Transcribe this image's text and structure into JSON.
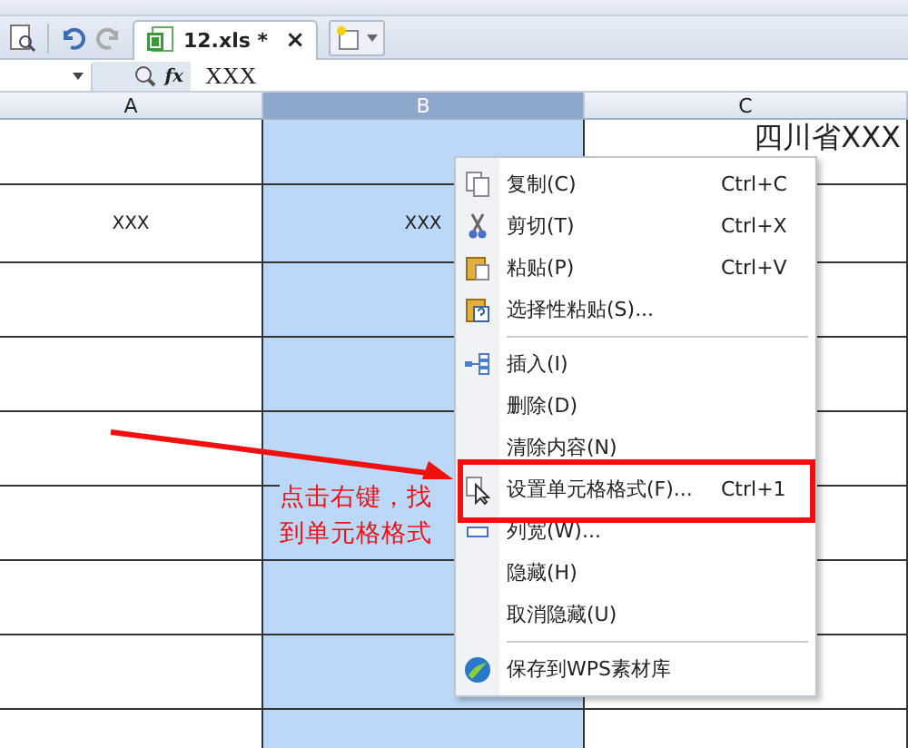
{
  "tabbar": {
    "tab": {
      "label": "12.xls *",
      "selected": true
    },
    "close": "×"
  },
  "formula_bar": {
    "fx": "fx",
    "value": "XXX"
  },
  "columns": [
    {
      "label": "A",
      "selected": false
    },
    {
      "label": "B",
      "selected": true
    },
    {
      "label": "C",
      "selected": false
    }
  ],
  "rows": [
    {
      "c": "四川省XXX"
    },
    {
      "a": "XXX",
      "b": "XXX"
    }
  ],
  "context_menu": [
    {
      "kind": "item",
      "label": "复制(C)",
      "shortcut": "Ctrl+C"
    },
    {
      "kind": "item",
      "label": "剪切(T)",
      "shortcut": "Ctrl+X"
    },
    {
      "kind": "item",
      "label": "粘贴(P)",
      "shortcut": "Ctrl+V"
    },
    {
      "kind": "item",
      "label": "选择性粘贴(S)..."
    },
    {
      "kind": "separator"
    },
    {
      "kind": "item",
      "label": "插入(I)"
    },
    {
      "kind": "item",
      "label": "删除(D)"
    },
    {
      "kind": "item",
      "label": "清除内容(N)"
    },
    {
      "kind": "item",
      "label": "设置单元格格式(F)...",
      "shortcut": "Ctrl+1"
    },
    {
      "kind": "item",
      "label": "列宽(W)..."
    },
    {
      "kind": "item",
      "label": "隐藏(H)"
    },
    {
      "kind": "item",
      "label": "取消隐藏(U)"
    },
    {
      "kind": "separator"
    },
    {
      "kind": "item",
      "label": "保存到WPS素材库"
    }
  ],
  "annotation": {
    "text": "点击右键，找到单元格格式"
  }
}
